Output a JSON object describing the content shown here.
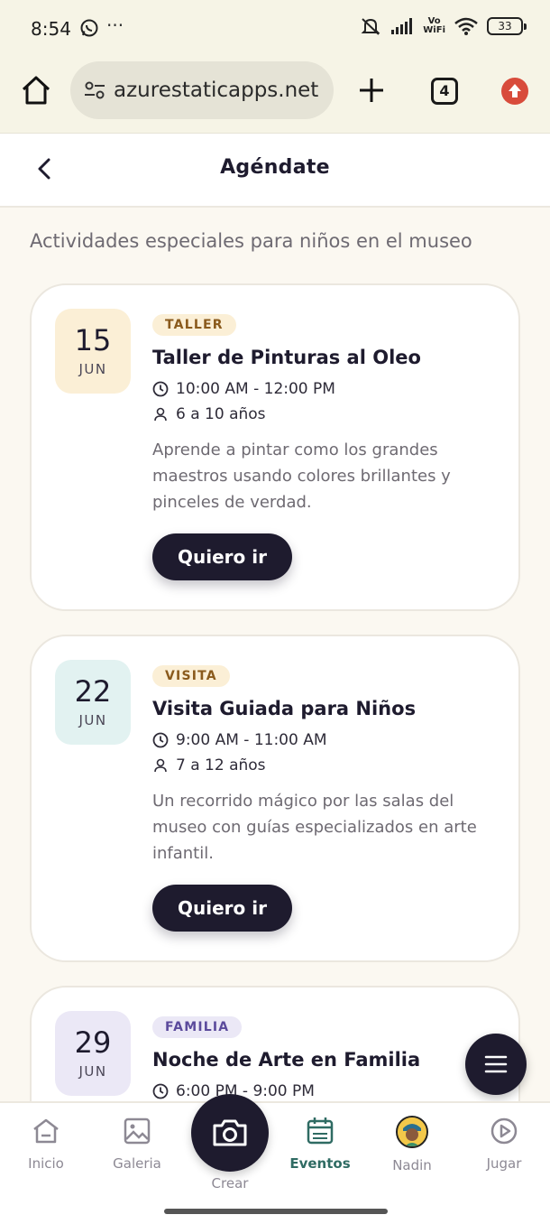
{
  "status_bar": {
    "time": "8:54",
    "battery": "33",
    "network_label_top": "Vo",
    "network_label_bottom": "WiFi"
  },
  "browser": {
    "url": "azurestaticapps.net",
    "tab_count": "4"
  },
  "header": {
    "title": "Agéndate"
  },
  "subtitle": "Actividades especiales para niños en el museo",
  "events": [
    {
      "day": "15",
      "month": "JUN",
      "date_bg": "#fbefd6",
      "tag": "TALLER",
      "tag_bg": "#fbefd6",
      "tag_color": "#8a5a1c",
      "title": "Taller de Pinturas al Oleo",
      "time": "10:00 AM - 12:00 PM",
      "ages": "6 a 10 años",
      "description": "Aprende a pintar como los grandes maestros usando colores brillantes y pinceles de verdad.",
      "cta": "Quiero ir"
    },
    {
      "day": "22",
      "month": "JUN",
      "date_bg": "#e2f2f1",
      "tag": "VISITA",
      "tag_bg": "#fbefd6",
      "tag_color": "#8a5a1c",
      "title": "Visita Guiada para Niños",
      "time": "9:00 AM - 11:00 AM",
      "ages": "7 a 12 años",
      "description": "Un recorrido mágico por las salas del museo con guías especializados en arte infantil.",
      "cta": "Quiero ir"
    },
    {
      "day": "29",
      "month": "JUN",
      "date_bg": "#ebe8f6",
      "tag": "FAMILIA",
      "tag_bg": "#ebe8f6",
      "tag_color": "#5b4a9c",
      "title": "Noche de Arte en Familia",
      "time": "6:00 PM - 9:00 PM"
    }
  ],
  "nav": {
    "inicio": "Inicio",
    "galeria": "Galeria",
    "crear": "Crear",
    "eventos": "Eventos",
    "nadin": "Nadin",
    "jugar": "Jugar"
  },
  "colors": {
    "primary": "#1e1b2e",
    "active_nav": "#2f6b63",
    "background": "#fbf8f1"
  }
}
